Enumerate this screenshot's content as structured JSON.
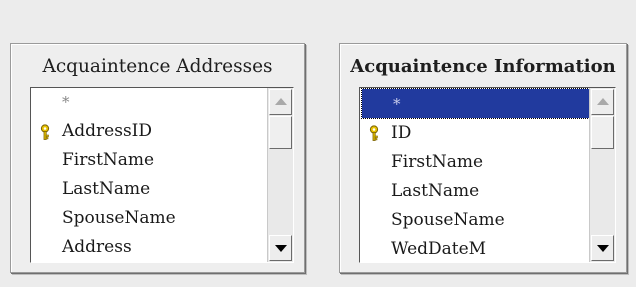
{
  "windows": [
    {
      "title": "Acquaintence Addresses",
      "fields": [
        "*",
        "AddressID",
        "FirstName",
        "LastName",
        "SpouseName",
        "Address"
      ],
      "key_field": "AddressID",
      "selected_field": null
    },
    {
      "title": "Acquaintence Information",
      "fields": [
        "*",
        "ID",
        "FirstName",
        "LastName",
        "SpouseName",
        "WedDateM"
      ],
      "key_field": "ID",
      "selected_field": "*"
    }
  ],
  "colors": {
    "selection": "#213a9e",
    "key_icon": "#e8c200"
  },
  "icons": {
    "primary_key": "key-icon",
    "scroll_up": "arrow-up-icon",
    "scroll_down": "arrow-down-icon"
  }
}
